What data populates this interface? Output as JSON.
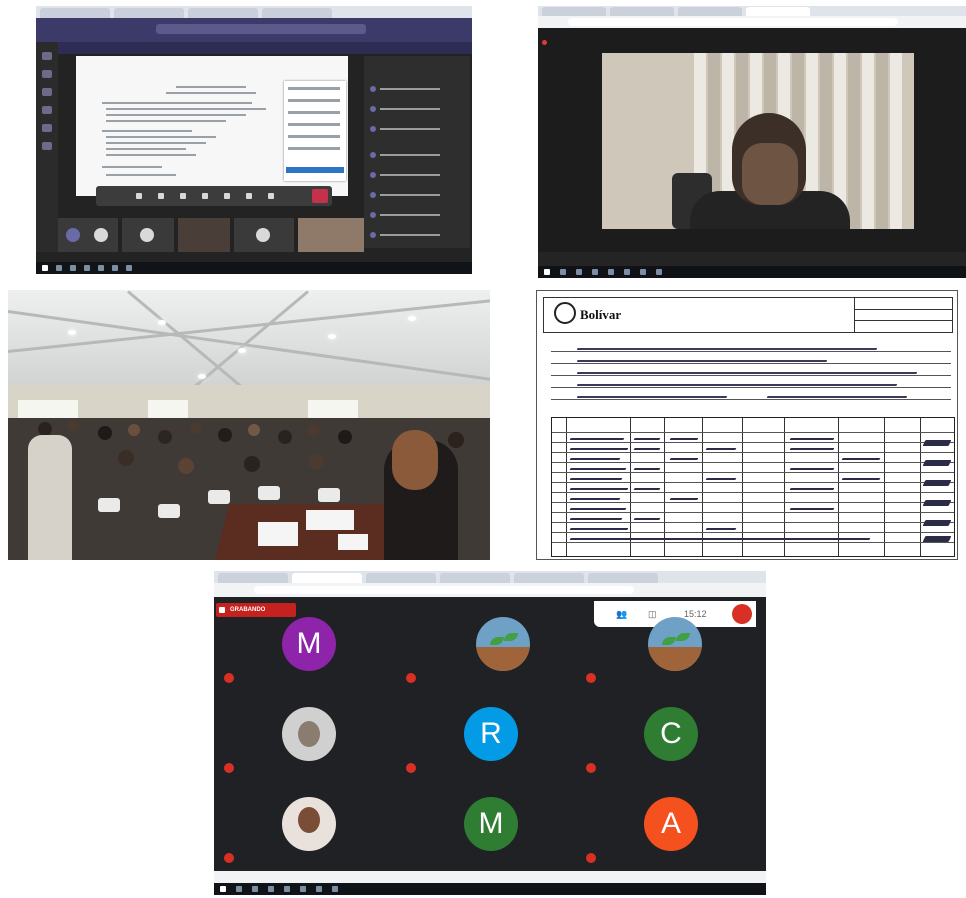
{
  "panel5": {
    "recording_label": "GRABANDO",
    "time": "15:12",
    "participants": [
      {
        "initial": "M",
        "color": "#8e24aa"
      },
      {
        "initial": ""
      },
      {
        "initial": ""
      },
      {
        "initial": ""
      },
      {
        "initial": "R",
        "color": "#039be5"
      },
      {
        "initial": "C",
        "color": "#2e7d32"
      },
      {
        "initial": ""
      },
      {
        "initial": "M",
        "color": "#2e7d32"
      },
      {
        "initial": "A",
        "color": "#f4511e"
      }
    ]
  },
  "panel4": {
    "logo_text": "Bolívar"
  },
  "colors": {
    "teams_purple": "#3b3a68",
    "meet_dark": "#202124",
    "recording_red": "#c5221f",
    "hangup_red": "#c4314b"
  }
}
